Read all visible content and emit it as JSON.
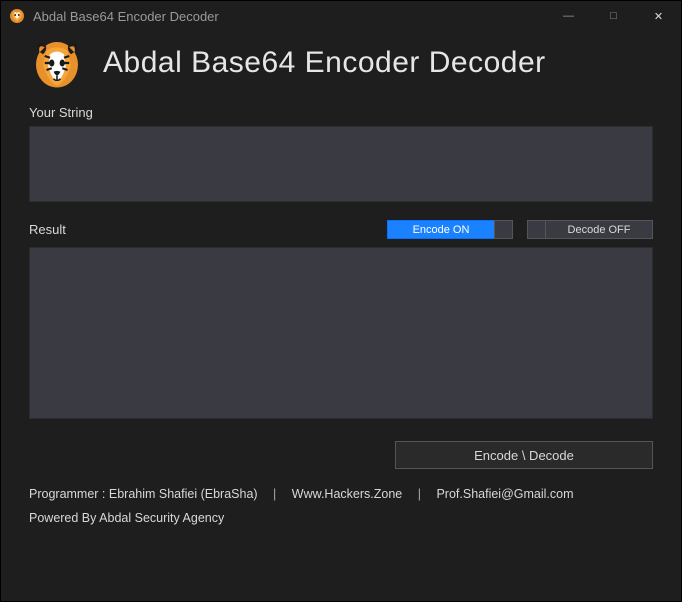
{
  "window": {
    "title": "Abdal Base64 Encoder Decoder"
  },
  "header": {
    "app_title": "Abdal Base64 Encoder Decoder"
  },
  "labels": {
    "input": "Your String",
    "result": "Result"
  },
  "fields": {
    "input_value": "",
    "result_value": ""
  },
  "toggles": {
    "encode_label": "Encode ON",
    "decode_label": "Decode OFF"
  },
  "buttons": {
    "action": "Encode \\ Decode"
  },
  "footer": {
    "programmer_label": "Programmer : Ebrahim Shafiei (EbraSha)",
    "site": "Www.Hackers.Zone",
    "email": "Prof.Shafiei@Gmail.com",
    "powered": "Powered By Abdal Security Agency"
  }
}
